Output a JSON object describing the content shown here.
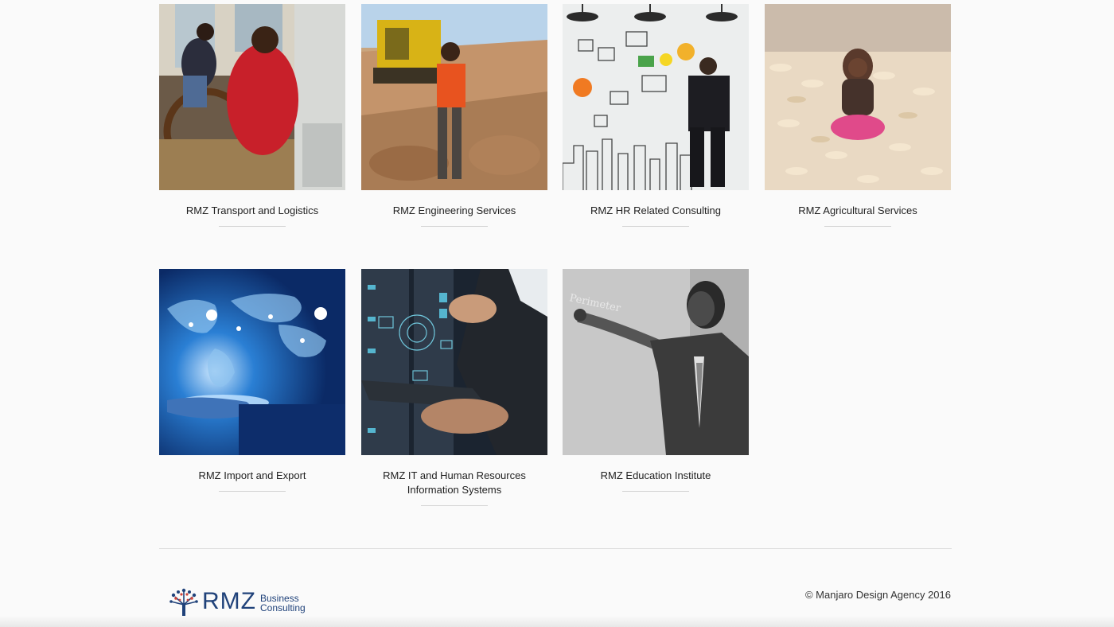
{
  "services": [
    {
      "name": "RMZ Transport and Logistics",
      "image": "photo-transport"
    },
    {
      "name": "RMZ Engineering Services",
      "image": "photo-engineering"
    },
    {
      "name": "RMZ HR Related Consulting",
      "image": "photo-hr-consulting"
    },
    {
      "name": "RMZ Agricultural Services",
      "image": "photo-agriculture"
    },
    {
      "name": "RMZ Import and Export",
      "image": "photo-import-export"
    },
    {
      "name": "RMZ IT and Human Resources Information Systems",
      "image": "photo-it-systems"
    },
    {
      "name": "RMZ Education Institute",
      "image": "photo-education"
    }
  ],
  "footer": {
    "logo": {
      "mark": "tree-logo-icon",
      "word": "RMZ",
      "line1": "Business",
      "line2": "Consulting"
    },
    "copyright": "© Manjaro Design Agency 2016"
  },
  "colors": {
    "brand": "#20427a",
    "background": "#fafafa",
    "divider": "#dcdcdc"
  }
}
